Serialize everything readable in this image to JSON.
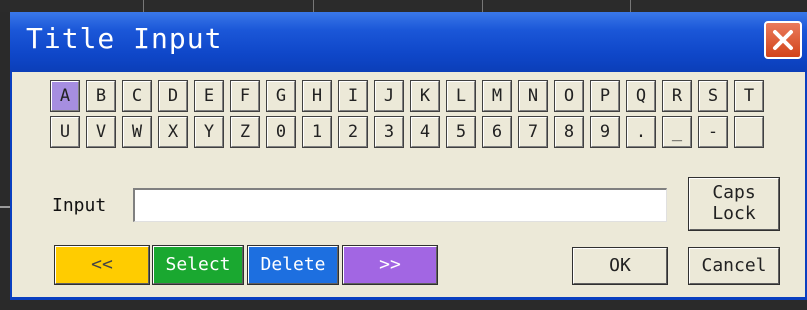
{
  "window": {
    "title": "Title Input"
  },
  "keyboard": {
    "row1": [
      "A",
      "B",
      "C",
      "D",
      "E",
      "F",
      "G",
      "H",
      "I",
      "J",
      "K",
      "L",
      "M",
      "N",
      "O",
      "P",
      "Q",
      "R",
      "S",
      "T"
    ],
    "row2": [
      "U",
      "V",
      "W",
      "X",
      "Y",
      "Z",
      "0",
      "1",
      "2",
      "3",
      "4",
      "5",
      "6",
      "7",
      "8",
      "9",
      ".",
      "_",
      "-",
      ""
    ],
    "selected_key": "A"
  },
  "input": {
    "label": "Input",
    "value": ""
  },
  "buttons": {
    "caps_lock": "Caps\nLock",
    "prev": "<<",
    "select": "Select",
    "delete": "Delete",
    "next": ">>",
    "ok": "OK",
    "cancel": "Cancel"
  },
  "colors": {
    "titlebar": "#0f47c9",
    "selected_key": "#a68ee0",
    "prev": "#ffcc00",
    "select": "#1aa830",
    "delete": "#1d6fe0",
    "next": "#a266e3"
  }
}
